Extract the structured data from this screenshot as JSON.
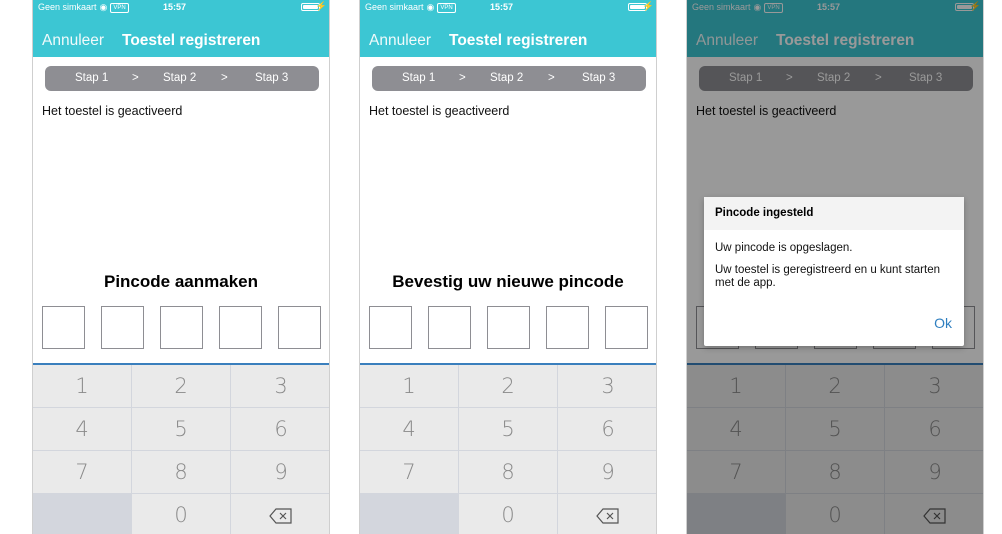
{
  "status_bar": {
    "carrier": "Geen simkaart",
    "vpn": "VPN",
    "time": "15:57"
  },
  "nav": {
    "cancel_label": "Annuleer",
    "title": "Toestel registreren"
  },
  "stepper": {
    "step1": "Stap 1",
    "separator": ">",
    "step2": "Stap 2",
    "step3": "Stap 3"
  },
  "message": "Het toestel is geactiveerd",
  "screens": [
    {
      "pin_title": "Pincode aanmaken"
    },
    {
      "pin_title": "Bevestig uw nieuwe pincode"
    }
  ],
  "keypad": {
    "keys": [
      "1",
      "2",
      "3",
      "4",
      "5",
      "6",
      "7",
      "8",
      "9",
      "0"
    ],
    "backspace_icon": "backspace-icon"
  },
  "dialog": {
    "title": "Pincode ingesteld",
    "line1": "Uw pincode is opgeslagen.",
    "line2": "Uw toestel is geregistreerd en u kunt starten met de app.",
    "ok_label": "Ok"
  },
  "colors": {
    "header": "#3cc6d3",
    "stepper": "#8e8e93",
    "keypad_accent": "#3a7fbd",
    "ok": "#2f7fc0"
  }
}
